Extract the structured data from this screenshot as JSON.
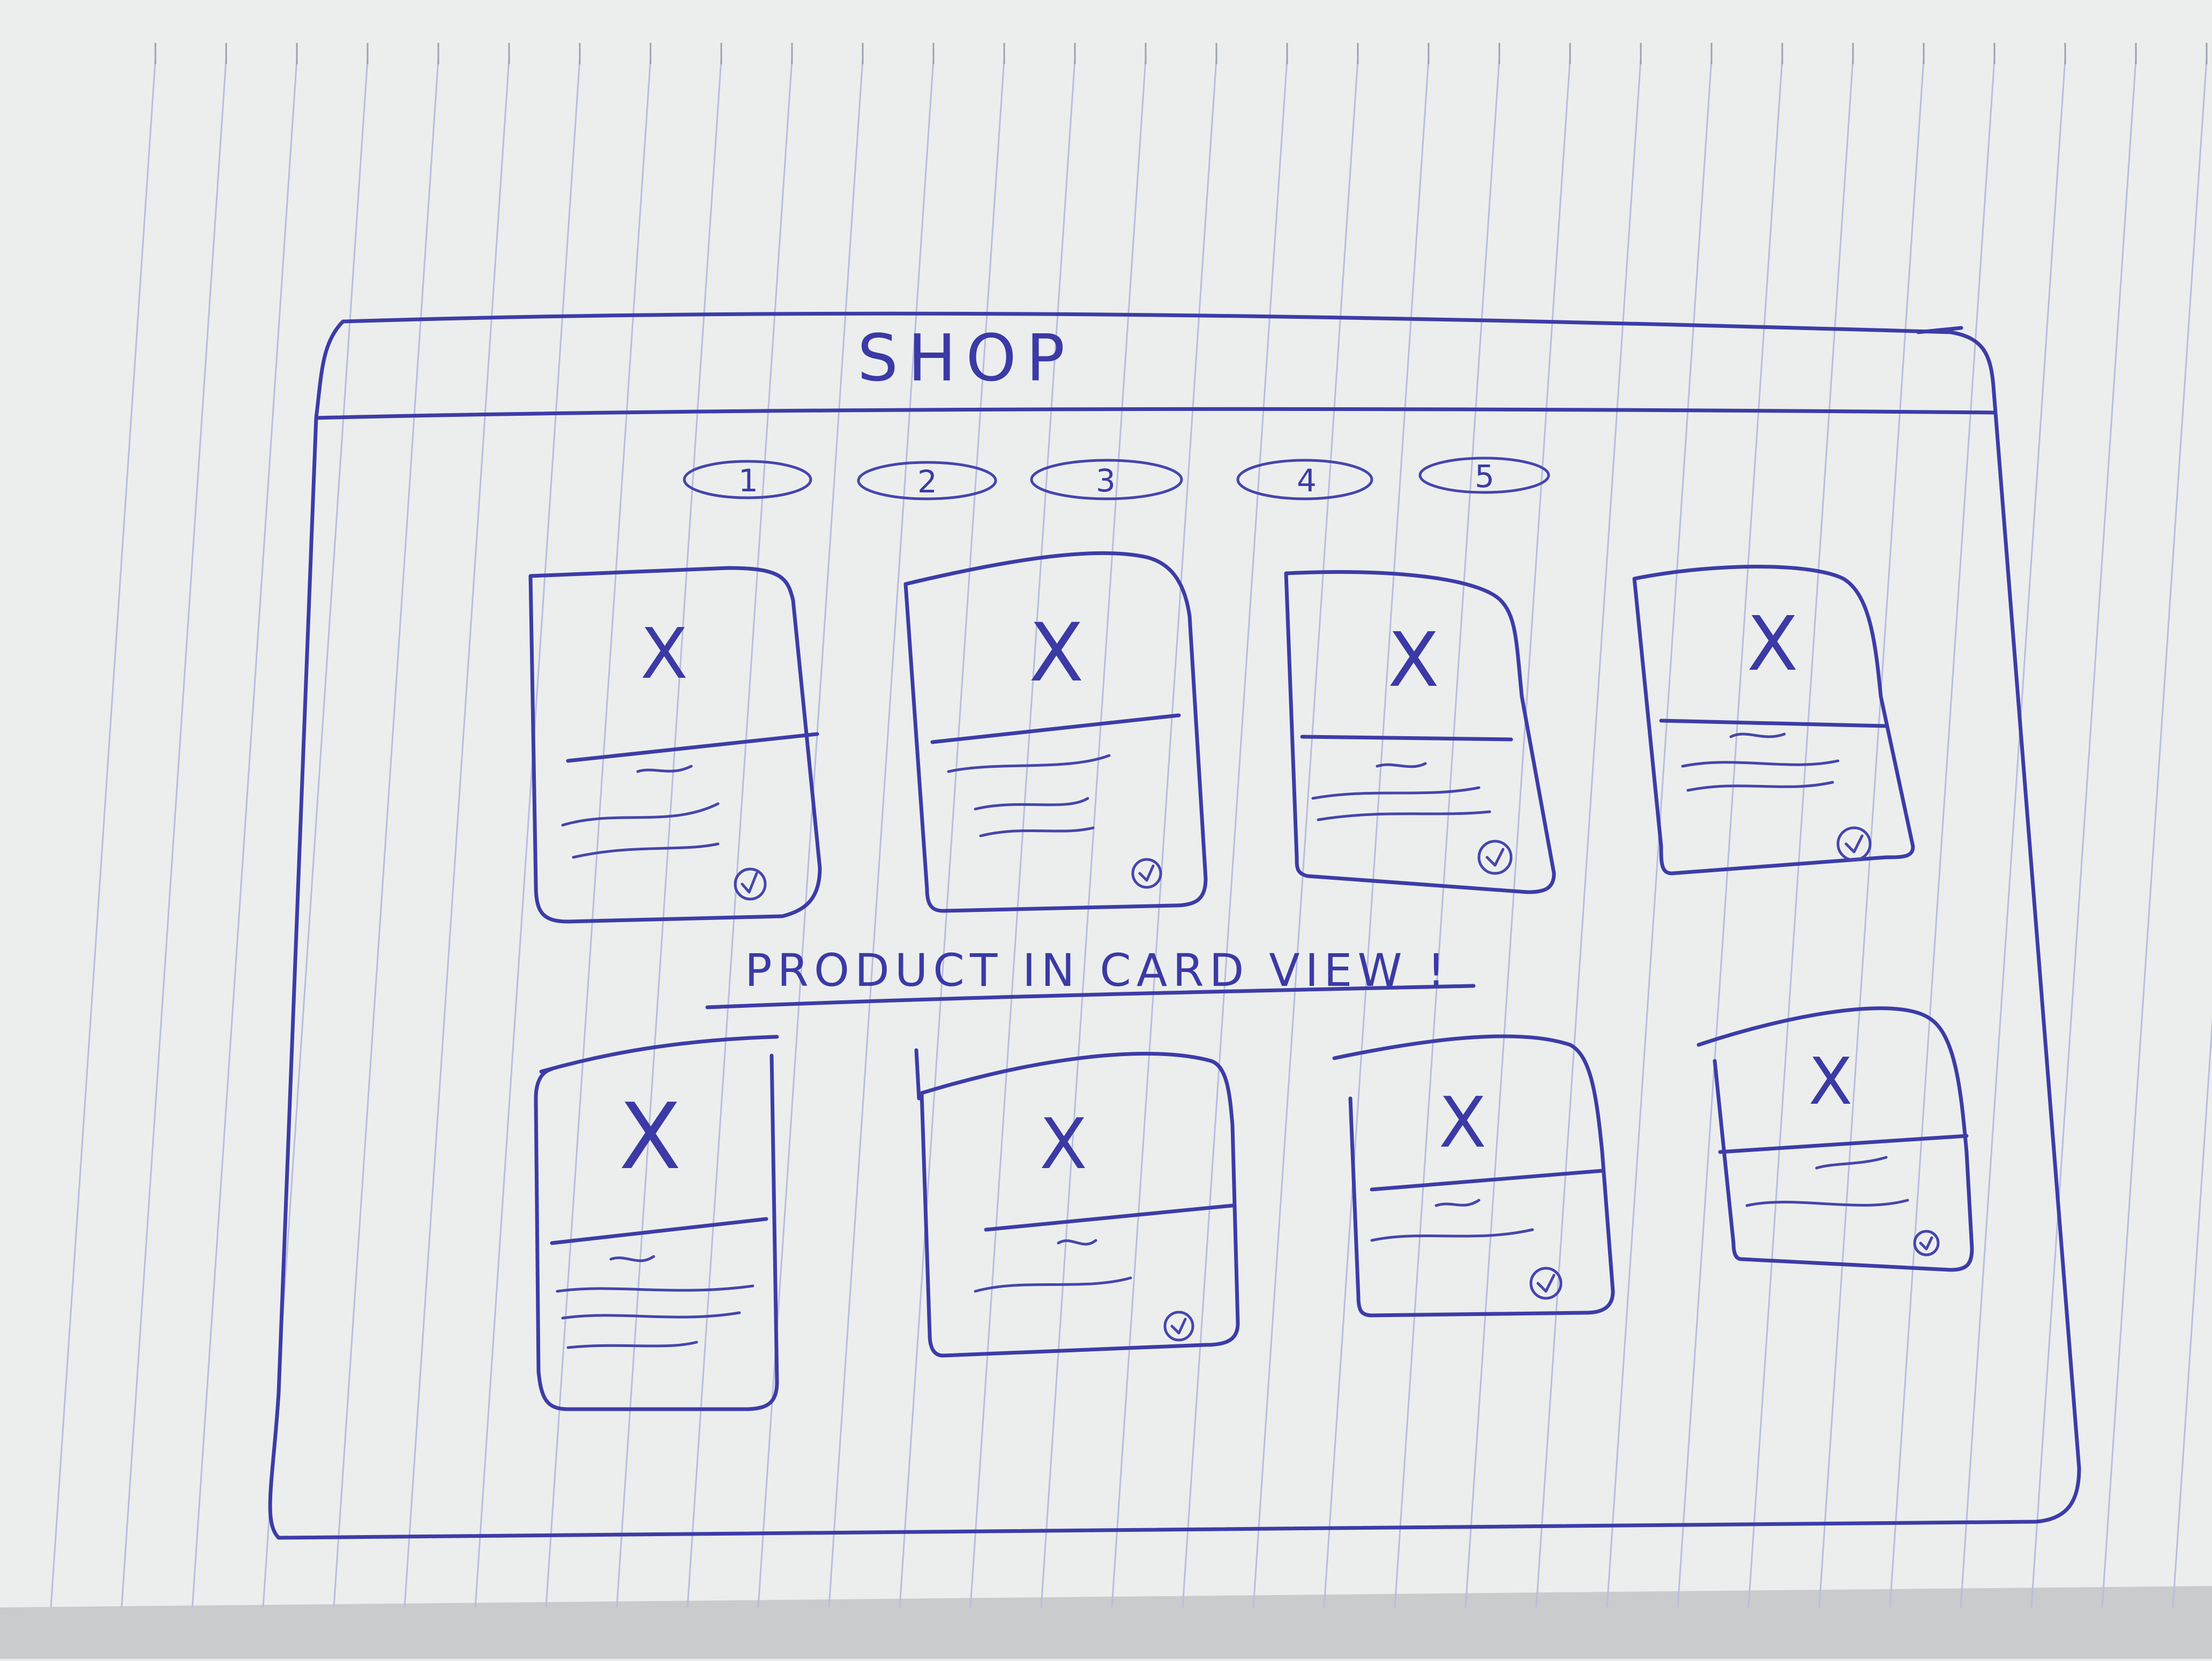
{
  "sketch": {
    "header": {
      "title": "SHOP"
    },
    "pagination": {
      "pages": [
        "1",
        "2",
        "3",
        "4",
        "5"
      ]
    },
    "caption": {
      "text": "PRODUCT IN CARD VIEW !"
    },
    "cards": {
      "count": 8,
      "rows": 2,
      "per_row": 4,
      "image_placeholder": "X",
      "badge_icon": "check-circle-icon"
    },
    "colors": {
      "ink": "#3d3ca8",
      "paper": "#e9ebea",
      "rules": "#b9bde0"
    }
  }
}
